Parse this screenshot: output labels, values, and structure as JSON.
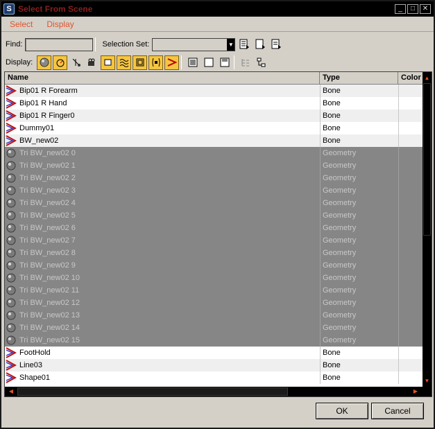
{
  "window": {
    "title": "Select From Scene",
    "app_icon_letter": "S"
  },
  "menu": [
    "Select",
    "Display"
  ],
  "find": {
    "label": "Find:",
    "value": ""
  },
  "selection_set": {
    "label": "Selection Set:",
    "value": ""
  },
  "display": {
    "label": "Display:"
  },
  "columns": [
    "Name",
    "Type",
    "Color"
  ],
  "rows": [
    {
      "name": "Bip01 R Forearm",
      "type": "Bone",
      "icon": "bone-icon",
      "selected": false
    },
    {
      "name": "Bip01 R Hand",
      "type": "Bone",
      "icon": "bone-icon",
      "selected": false
    },
    {
      "name": "Bip01 R Finger0",
      "type": "Bone",
      "icon": "bone-icon",
      "selected": false
    },
    {
      "name": "Dummy01",
      "type": "Bone",
      "icon": "bone-icon",
      "selected": false
    },
    {
      "name": "BW_new02",
      "type": "Bone",
      "icon": "bone-icon",
      "selected": false
    },
    {
      "name": "Tri BW_new02 0",
      "type": "Geometry",
      "icon": "sphere-icon",
      "selected": true
    },
    {
      "name": "Tri BW_new02 1",
      "type": "Geometry",
      "icon": "sphere-icon",
      "selected": true
    },
    {
      "name": "Tri BW_new02 2",
      "type": "Geometry",
      "icon": "sphere-icon",
      "selected": true
    },
    {
      "name": "Tri BW_new02 3",
      "type": "Geometry",
      "icon": "sphere-icon",
      "selected": true
    },
    {
      "name": "Tri BW_new02 4",
      "type": "Geometry",
      "icon": "sphere-icon",
      "selected": true
    },
    {
      "name": "Tri BW_new02 5",
      "type": "Geometry",
      "icon": "sphere-icon",
      "selected": true
    },
    {
      "name": "Tri BW_new02 6",
      "type": "Geometry",
      "icon": "sphere-icon",
      "selected": true
    },
    {
      "name": "Tri BW_new02 7",
      "type": "Geometry",
      "icon": "sphere-icon",
      "selected": true
    },
    {
      "name": "Tri BW_new02 8",
      "type": "Geometry",
      "icon": "sphere-icon",
      "selected": true
    },
    {
      "name": "Tri BW_new02 9",
      "type": "Geometry",
      "icon": "sphere-icon",
      "selected": true
    },
    {
      "name": "Tri BW_new02 10",
      "type": "Geometry",
      "icon": "sphere-icon",
      "selected": true
    },
    {
      "name": "Tri BW_new02 11",
      "type": "Geometry",
      "icon": "sphere-icon",
      "selected": true
    },
    {
      "name": "Tri BW_new02 12",
      "type": "Geometry",
      "icon": "sphere-icon",
      "selected": true
    },
    {
      "name": "Tri BW_new02 13",
      "type": "Geometry",
      "icon": "sphere-icon",
      "selected": true
    },
    {
      "name": "Tri BW_new02 14",
      "type": "Geometry",
      "icon": "sphere-icon",
      "selected": true
    },
    {
      "name": "Tri BW_new02 15",
      "type": "Geometry",
      "icon": "sphere-icon",
      "selected": true
    },
    {
      "name": "FootHold",
      "type": "Bone",
      "icon": "bone-icon",
      "selected": false
    },
    {
      "name": "Line03",
      "type": "Bone",
      "icon": "bone-icon",
      "selected": false
    },
    {
      "name": "Shape01",
      "type": "Bone",
      "icon": "bone-icon",
      "selected": false
    }
  ],
  "buttons": {
    "ok": "OK",
    "cancel": "Cancel"
  },
  "colors": {
    "menu_text": "#e0542c",
    "title_text": "#8a1f1f",
    "selected_row": "#868686",
    "toggle_on": "#f5c542"
  }
}
